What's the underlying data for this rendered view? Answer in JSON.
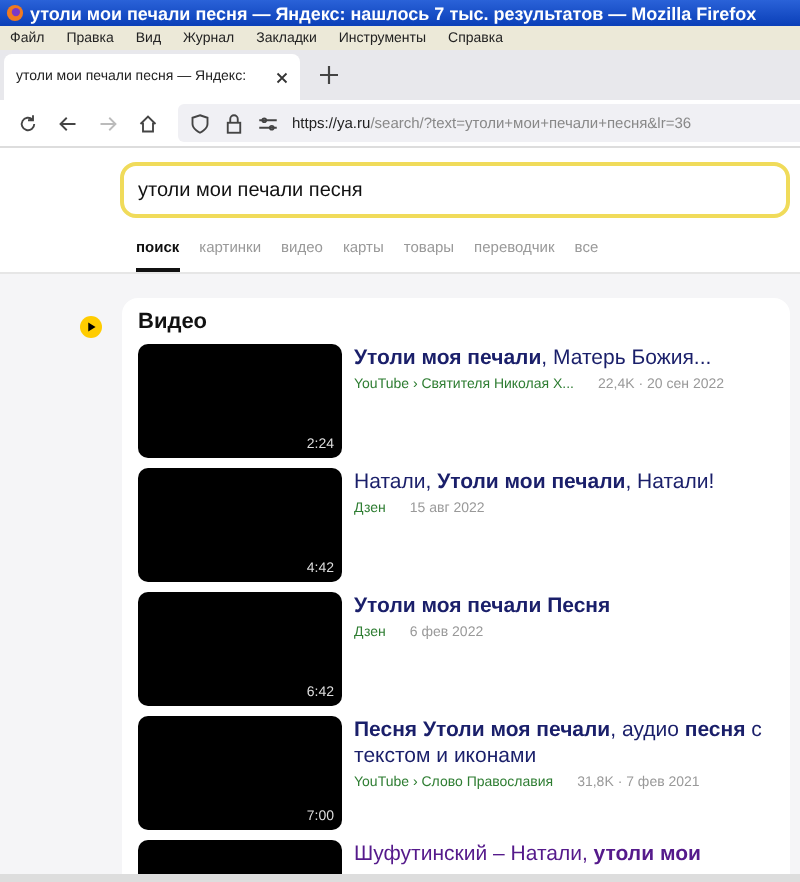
{
  "window": {
    "title": "утоли мои печали песня — Яндекс: нашлось 7 тыс. результатов — Mozilla Firefox"
  },
  "menu": [
    "Файл",
    "Правка",
    "Вид",
    "Журнал",
    "Закладки",
    "Инструменты",
    "Справка"
  ],
  "browser_tabs": [
    {
      "label": "утоли мои печали песня — Яндекс:",
      "selected": true
    }
  ],
  "address_bar": {
    "host": "https://ya.ru",
    "path": "/search/?text=утоли+мои+печали+песня&lr=36"
  },
  "search": {
    "value": "утоли мои печали песня"
  },
  "search_tabs": [
    {
      "label": "поиск",
      "selected": true
    },
    {
      "label": "картинки",
      "selected": false
    },
    {
      "label": "видео",
      "selected": false
    },
    {
      "label": "карты",
      "selected": false
    },
    {
      "label": "товары",
      "selected": false
    },
    {
      "label": "переводчик",
      "selected": false
    },
    {
      "label": "все",
      "selected": false
    }
  ],
  "video_section": {
    "heading": "Видео",
    "items": [
      {
        "title": "**Утоли моя печали**, Матерь Божия...",
        "source": "YouTube › Святителя Николая Х...",
        "info": "22,4K · 20 сен 2022",
        "duration": "2:24",
        "visited": false
      },
      {
        "title": "Натали, **Утоли мои печали**, Натали!",
        "source": "Дзен",
        "info": "15 авг 2022",
        "duration": "4:42",
        "visited": false
      },
      {
        "title": "**Утоли моя печали Песня**",
        "source": "Дзен",
        "info": "6 фев 2022",
        "duration": "6:42",
        "visited": false
      },
      {
        "title": "**Песня Утоли моя печали**, аудио **песня** с текстом и иконами",
        "source": "YouTube › Слово Православия",
        "info": "31,8K · 7 фев 2021",
        "duration": "7:00",
        "visited": false
      },
      {
        "title": "Шуфутинский – Натали, **утоли мои**",
        "visited": true
      }
    ]
  }
}
